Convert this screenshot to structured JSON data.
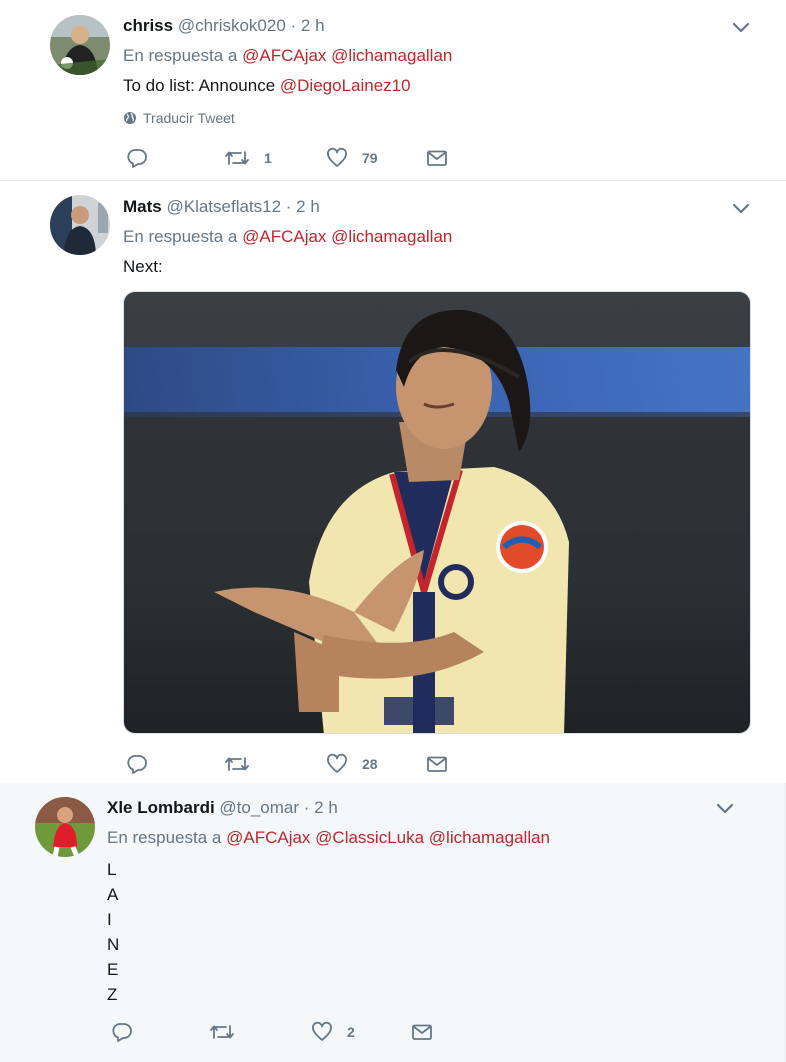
{
  "tweets": [
    {
      "name": "chriss",
      "handle": "@chriskok020",
      "time": "· 2 h",
      "reply_prefix": "En respuesta a",
      "mentions": [
        "@AFCAjax",
        "@lichamagallan"
      ],
      "text_prefix": "To do list: Announce ",
      "text_mention": "@DiegoLainez10",
      "translate": "Traducir Tweet",
      "retweets": "1",
      "likes": "79"
    },
    {
      "name": "Mats",
      "handle": "@Klatseflats12",
      "time": "· 2 h",
      "reply_prefix": "En respuesta a",
      "mentions": [
        "@AFCAjax",
        "@lichamagallan"
      ],
      "text": "Next:",
      "retweets": "",
      "likes": "28"
    },
    {
      "name": "Xle Lombardi",
      "handle": "@to_omar",
      "time": "· 2 h",
      "reply_prefix": "En respuesta a",
      "mentions": [
        "@AFCAjax",
        "@ClassicLuka",
        "@lichamagallan"
      ],
      "letters": [
        "L",
        "A",
        "I",
        "N",
        "E",
        "Z"
      ],
      "retweets": "",
      "likes": "2"
    }
  ],
  "colors": {
    "mention": "#c4242b",
    "secondary_text": "#657786",
    "highlight_bg": "#f5f8fa"
  },
  "icons": [
    "reply-icon",
    "retweet-icon",
    "like-icon",
    "message-icon",
    "chevron-down-icon",
    "globe-icon"
  ]
}
